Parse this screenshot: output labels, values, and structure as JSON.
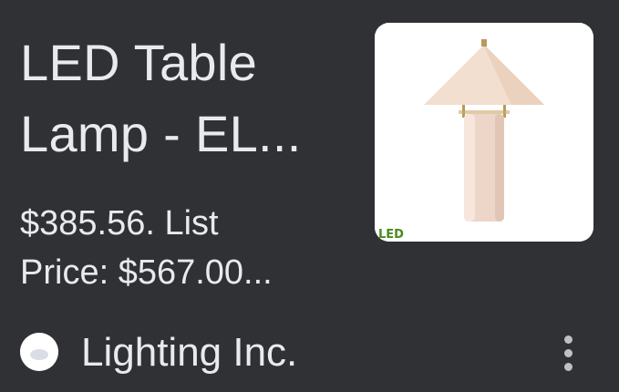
{
  "result": {
    "title_line1": "LED Table",
    "title_line2": "Lamp - EL...",
    "price_line1": "$385.56. List",
    "price_line2": "Price: $567.00...",
    "source": "Lighting Inc.",
    "thumbnail": {
      "icon": "table-lamp-image",
      "badge": "LED"
    },
    "more_icon": "more-vert-icon"
  },
  "colors": {
    "background": "#303134",
    "text": "#e8eaed",
    "icon": "#bdc1c6"
  }
}
